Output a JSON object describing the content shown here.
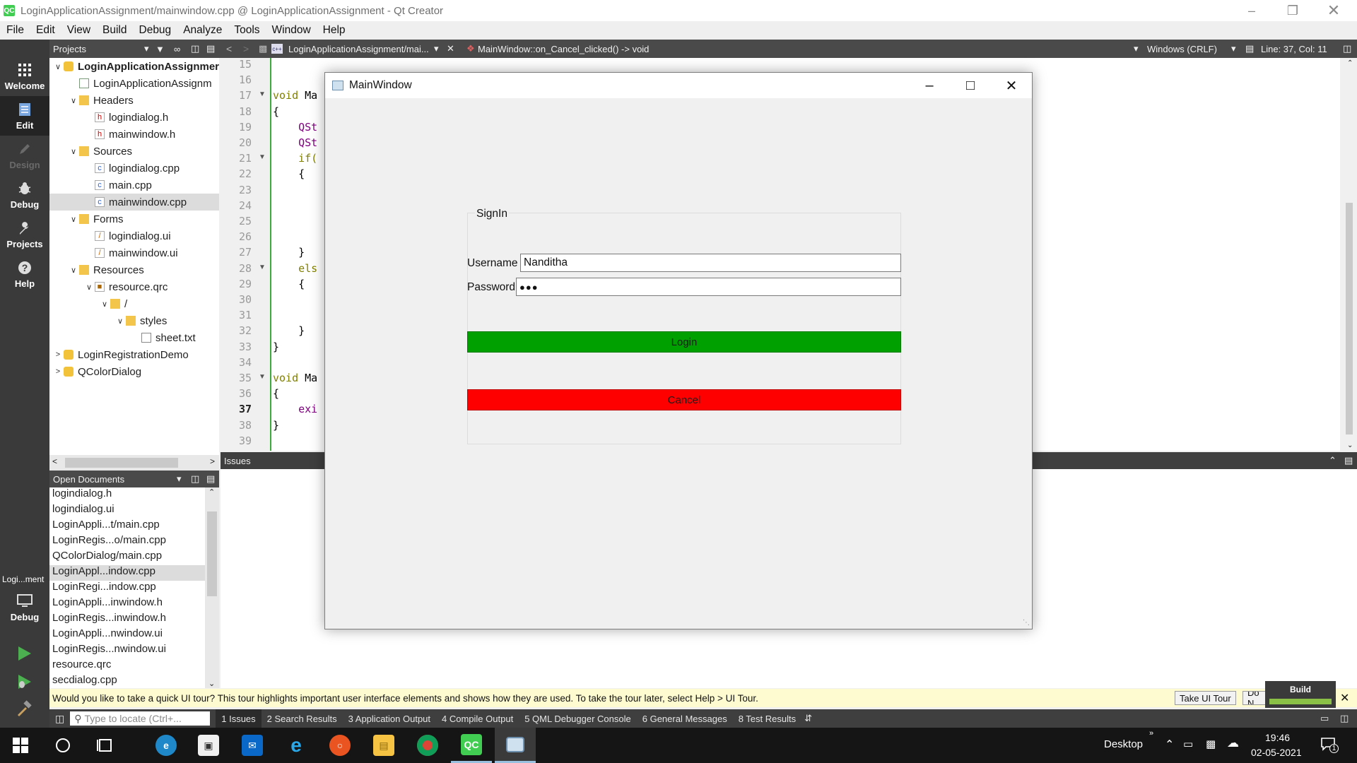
{
  "window": {
    "title": "LoginApplicationAssignment/mainwindow.cpp @ LoginApplicationAssignment - Qt Creator",
    "app_icon": "QC"
  },
  "menu": [
    "File",
    "Edit",
    "View",
    "Build",
    "Debug",
    "Analyze",
    "Tools",
    "Window",
    "Help"
  ],
  "modes": {
    "welcome": "Welcome",
    "edit": "Edit",
    "design": "Design",
    "debug": "Debug",
    "projects": "Projects",
    "help": "Help",
    "kit_label": "Logi...ment",
    "kit_mode": "Debug"
  },
  "projects_pane": {
    "title": "Projects",
    "tree": [
      {
        "label": "LoginApplicationAssignmer",
        "icon": "project-icon"
      },
      {
        "label": "LoginApplicationAssignm",
        "icon": "pro-file-icon"
      },
      {
        "label": "Headers",
        "icon": "folder-icon"
      },
      {
        "label": "logindialog.h",
        "icon": "header-file-icon"
      },
      {
        "label": "mainwindow.h",
        "icon": "header-file-icon"
      },
      {
        "label": "Sources",
        "icon": "folder-icon"
      },
      {
        "label": "logindialog.cpp",
        "icon": "cpp-file-icon"
      },
      {
        "label": "main.cpp",
        "icon": "cpp-file-icon"
      },
      {
        "label": "mainwindow.cpp",
        "icon": "cpp-file-icon"
      },
      {
        "label": "Forms",
        "icon": "folder-icon"
      },
      {
        "label": "logindialog.ui",
        "icon": "ui-file-icon"
      },
      {
        "label": "mainwindow.ui",
        "icon": "ui-file-icon"
      },
      {
        "label": "Resources",
        "icon": "folder-icon"
      },
      {
        "label": "resource.qrc",
        "icon": "qrc-file-icon"
      },
      {
        "label": "/",
        "icon": "folder-icon"
      },
      {
        "label": "styles",
        "icon": "folder-icon"
      },
      {
        "label": "sheet.txt",
        "icon": "text-file-icon"
      },
      {
        "label": "LoginRegistrationDemo",
        "icon": "project-icon"
      },
      {
        "label": "QColorDialog",
        "icon": "project-icon"
      }
    ]
  },
  "editor_toolbar": {
    "file_combo": "LoginApplicationAssignment/mai...",
    "symbol_combo": "MainWindow::on_Cancel_clicked() -> void",
    "line_ending": "Windows (CRLF)",
    "cursor_pos": "Line: 37, Col: 11"
  },
  "editor": {
    "line_numbers": [
      "15",
      "16",
      "17",
      "18",
      "19",
      "20",
      "21",
      "22",
      "23",
      "24",
      "25",
      "26",
      "27",
      "28",
      "29",
      "30",
      "31",
      "32",
      "33",
      "34",
      "35",
      "36",
      "37",
      "38",
      "39"
    ],
    "lines": [
      {
        "n": "17",
        "kw": "void",
        "rest": " Ma"
      },
      {
        "n": "18",
        "kw": "",
        "rest": "{"
      },
      {
        "n": "19",
        "kw": "",
        "rest": "    QSt"
      },
      {
        "n": "20",
        "kw": "",
        "rest": "    QSt"
      },
      {
        "n": "21",
        "kw": "",
        "rest": "    if("
      },
      {
        "n": "22",
        "kw": "",
        "rest": "    {"
      },
      {
        "n": "27",
        "kw": "",
        "rest": "    }"
      },
      {
        "n": "28",
        "kw": "",
        "rest": "    els"
      },
      {
        "n": "29",
        "kw": "",
        "rest": "    {"
      },
      {
        "n": "32",
        "kw": "",
        "rest": "    }"
      },
      {
        "n": "33",
        "kw": "",
        "rest": "}"
      },
      {
        "n": "35",
        "kw": "void",
        "rest": " Ma"
      },
      {
        "n": "36",
        "kw": "",
        "rest": "{"
      },
      {
        "n": "37",
        "kw": "",
        "rest": "    exi"
      },
      {
        "n": "38",
        "kw": "",
        "rest": "}"
      }
    ]
  },
  "open_documents": {
    "title": "Open Documents",
    "items": [
      "logindialog.h",
      "logindialog.ui",
      "LoginAppli...t/main.cpp",
      "LoginRegis...o/main.cpp",
      "QColorDialog/main.cpp",
      "LoginAppl...indow.cpp",
      "LoginRegi...indow.cpp",
      "LoginAppli...inwindow.h",
      "LoginRegis...inwindow.h",
      "LoginAppli...nwindow.ui",
      "LoginRegis...nwindow.ui",
      "resource.qrc",
      "secdialog.cpp"
    ],
    "selected_index": 5
  },
  "issues_pane": {
    "title": "Issues"
  },
  "dialog": {
    "title": "MainWindow",
    "group_title": "SignIn",
    "username_label": "Username",
    "username_value": "Nanditha",
    "password_label": "Password",
    "password_value": "●●●",
    "login_label": "Login",
    "cancel_label": "Cancel",
    "login_color": "#00a000",
    "cancel_color": "#ff0000"
  },
  "infobar": {
    "message": "Would you like to take a quick UI tour? This tour highlights important user interface elements and shows how they are used. To take the tour later, select Help > UI Tour.",
    "tour_button": "Take UI Tour",
    "dismiss_button": "Do N",
    "build_label": "Build"
  },
  "status": {
    "locate_placeholder": "Type to locate (Ctrl+...",
    "tabs": [
      "1  Issues",
      "2  Search Results",
      "3  Application Output",
      "4  Compile Output",
      "5  QML Debugger Console",
      "6  General Messages",
      "8  Test Results"
    ]
  },
  "taskbar": {
    "desktop_label": "Desktop",
    "time": "19:46",
    "date": "02-05-2021",
    "notification_count": "1"
  }
}
